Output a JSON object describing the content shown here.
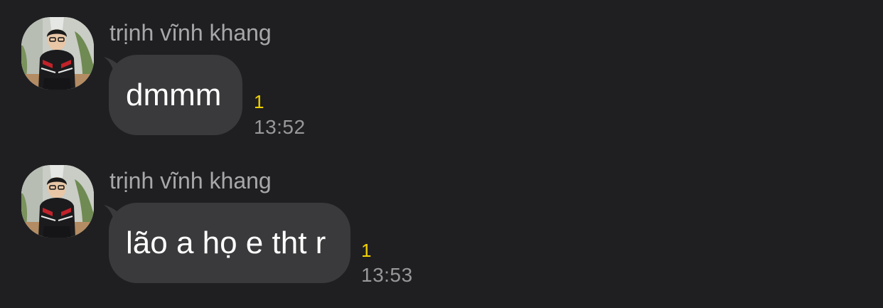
{
  "messages": [
    {
      "sender": "trịnh vĩnh khang",
      "text": "dmmm",
      "unread_count": "1",
      "time": "13:52"
    },
    {
      "sender": "trịnh vĩnh khang",
      "text": "lão a họ e tht r",
      "unread_count": "1",
      "time": "13:53"
    }
  ],
  "colors": {
    "background": "#1f1f21",
    "bubble": "#3a3a3c",
    "unread": "#f2d200",
    "meta_text": "#98989a"
  }
}
